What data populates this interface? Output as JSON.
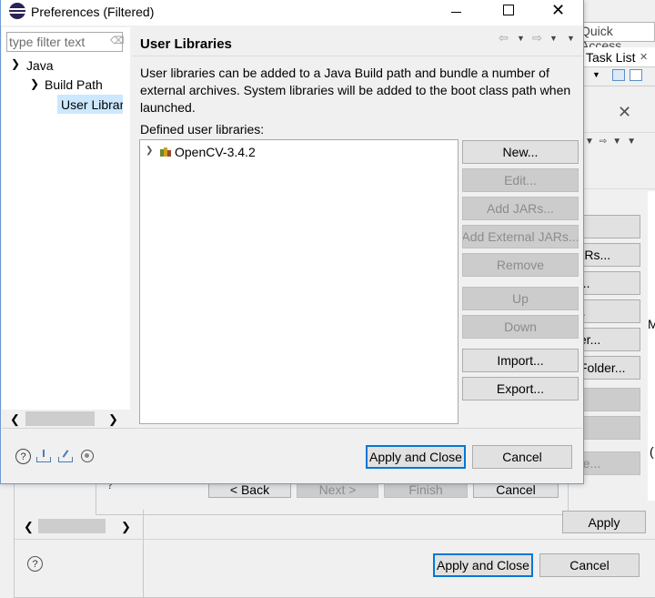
{
  "back_window": {
    "quick_access": "Quick Access",
    "task_list_tab": "Task List",
    "edge_letter": "M",
    "edge_letter_2": "(",
    "partial_buttons": [
      "...",
      "JARs...",
      "le...",
      "y...",
      "lder...",
      "s Folder...",
      "",
      "",
      "File..."
    ],
    "wizard_back": "< Back",
    "wizard_next": "Next >",
    "wizard_finish": "Finish",
    "wizard_cancel": "Cancel",
    "apply": "Apply",
    "apply_and_close": "Apply and Close",
    "cancel": "Cancel"
  },
  "dialog": {
    "title": "Preferences (Filtered)",
    "filter_placeholder": "type filter text",
    "tree": [
      {
        "label": "Java",
        "expanded": true
      },
      {
        "label": "Build Path",
        "expanded": true
      },
      {
        "label": "User Librar",
        "selected": true
      }
    ],
    "page_title": "User Libraries",
    "description": "User libraries can be added to a Java Build path and bundle a number of external archives. System libraries will be added to the boot class path when launched.",
    "defined_label": "Defined user libraries:",
    "libraries": [
      {
        "label": "OpenCV-3.4.2",
        "collapsed": true
      }
    ],
    "buttons": {
      "new": "New...",
      "edit": "Edit...",
      "add_jars": "Add JARs...",
      "add_external_jars": "Add External JARs...",
      "remove": "Remove",
      "up": "Up",
      "down": "Down",
      "import": "Import...",
      "export": "Export..."
    },
    "apply_and_close": "Apply and Close",
    "cancel": "Cancel"
  },
  "colors": {
    "accent": "#0078d7",
    "selection": "#cce8ff",
    "disabled_text": "#8c8c8c",
    "button_face": "#e1e1e1"
  }
}
